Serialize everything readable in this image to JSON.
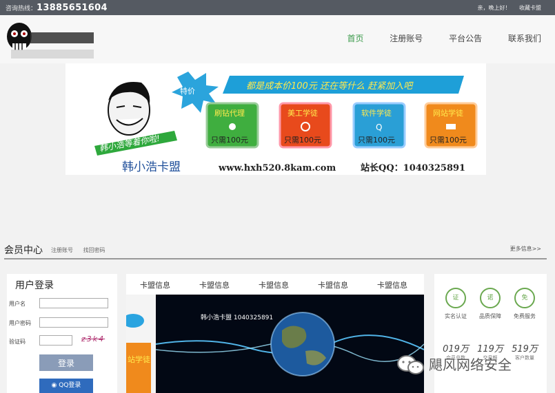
{
  "topbar": {
    "hotline_label": "咨询热线：",
    "hotline_number": "13885651604",
    "greeting": "亲，晚上好！",
    "bookmark": "收藏卡盟"
  },
  "nav": {
    "items": [
      "首页",
      "注册账号",
      "平台公告",
      "联系我们"
    ],
    "active": "首页"
  },
  "banner": {
    "tag": "特价",
    "slogan": "都是成本价100元 还在等什么 赶紧加入吧",
    "left_caption": "韩小浩等着你啦!",
    "cards": [
      {
        "title": "刷钻代理",
        "price": "只需100元",
        "color": "#3fae3f"
      },
      {
        "title": "美工学徒",
        "price": "只需100元",
        "color": "#e84a1c"
      },
      {
        "title": "软件学徒",
        "price": "只需100元",
        "color": "#2a9fd6"
      },
      {
        "title": "网站学徒",
        "price": "只需100元",
        "color": "#f08a1c"
      }
    ],
    "site_name": "韩小浩卡盟",
    "site_url": "www.hxh520.8kam.com",
    "qq": "站长QQ：1040325891"
  },
  "member": {
    "title": "会员中心",
    "links": [
      "注册账号",
      "找回密码"
    ],
    "more": "更多信息>>"
  },
  "login": {
    "title": "用户登录",
    "username_label": "用户名",
    "password_label": "用户密码",
    "captcha_label": "验证码",
    "captcha_text": "z3k4",
    "submit": "登录",
    "qq_login": "QQ登录"
  },
  "tabs": [
    "卡盟信息",
    "卡盟信息",
    "卡盟信息",
    "卡盟信息",
    "卡盟信息"
  ],
  "slide": {
    "caption": "韩小浩卡盟  1040325891",
    "side_text": "站学徒"
  },
  "features": [
    {
      "icon": "证",
      "label": "实名认证"
    },
    {
      "icon": "诺",
      "label": "品质保障"
    },
    {
      "icon": "免",
      "label": "免费服务"
    }
  ],
  "stats": [
    {
      "value": "019万",
      "label": "会员总数"
    },
    {
      "value": "119万",
      "label": "交易额"
    },
    {
      "value": "519万",
      "label": "客户数量"
    }
  ],
  "watermark": "飓风网络安全",
  "colors": {
    "topbar": "#555a62",
    "nav_active": "#3a9a4a",
    "login_button": "#8a9cb8",
    "qq_button": "#2f6bbd"
  }
}
